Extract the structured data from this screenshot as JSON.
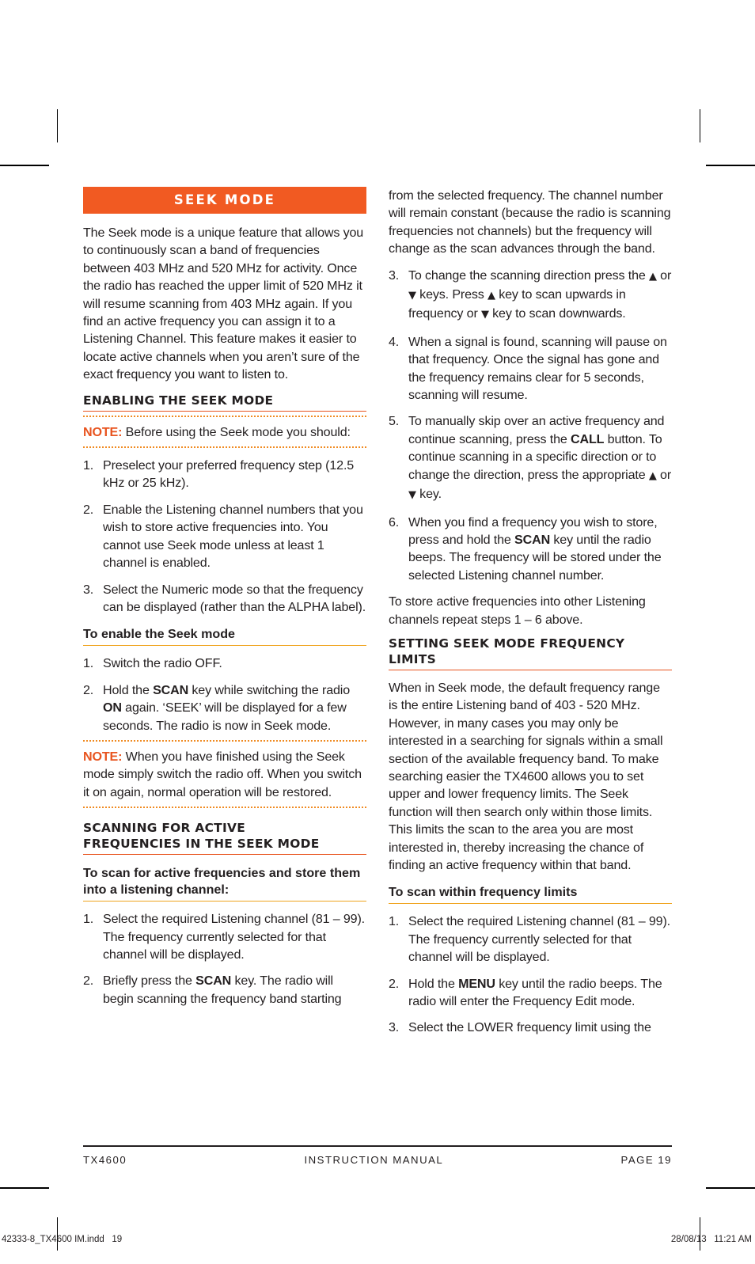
{
  "banner": {
    "title": "SEEK MODE"
  },
  "left_column": {
    "intro": "The Seek mode is a unique feature that allows you to continuously scan a band of frequencies between 403 MHz and 520 MHz for activity. Once the radio has reached the upper limit of 520 MHz it will resume scanning from 403 MHz again. If you find an active frequency you can assign it to a Listening Channel. This feature makes it easier to locate active channels when you aren’t sure of the exact frequency you want to listen to.",
    "section_enabling": "ENABLING THE SEEK MODE",
    "note1_label": "NOTE:",
    "note1_text": " Before using the Seek mode you should:",
    "steps_prep": [
      {
        "num": "1.",
        "text": "Preselect your preferred frequency step (12.5 kHz or 25 kHz)."
      },
      {
        "num": "2.",
        "text": "Enable the Listening channel numbers that you wish to store active frequencies into. You cannot use Seek mode unless at least 1 channel is enabled."
      },
      {
        "num": "3.",
        "text": "Select the Numeric mode so that the frequency can be displayed (rather than the ALPHA label)."
      }
    ],
    "subhead_enable": "To enable the Seek mode",
    "step_enable_1_num": "1.",
    "step_enable_1_text": "Switch the radio OFF.",
    "step_enable_2_num": "2.",
    "step_enable_2_a": "Hold the ",
    "step_enable_2_key1": "SCAN",
    "step_enable_2_b": " key while switching the radio ",
    "step_enable_2_key2": "ON",
    "step_enable_2_c": " again. ‘SEEK’ will be displayed for a few seconds. The radio is now in Seek mode.",
    "note2_label": "NOTE:",
    "note2_text": " When you have finished using the Seek mode simply switch the radio off. When you switch it on again, normal operation will be restored.",
    "section_scanning_line1": "SCANNING FOR ACTIVE",
    "section_scanning_line2": "FREQUENCIES IN THE SEEK MODE",
    "subhead_scan": "To scan for active frequencies and store them into a listening channel:",
    "step_scan_1_num": "1.",
    "step_scan_1_text": "Select the required Listening channel (81 – 99). The frequency currently selected for that channel will be displayed.",
    "step_scan_2_num": "2.",
    "step_scan_2_a": "Briefly press the ",
    "step_scan_2_key": "SCAN",
    "step_scan_2_b": " key. The radio will begin scanning the frequency band starting"
  },
  "right_column": {
    "continued_text": "from the selected frequency. The channel number will remain constant (because the radio is scanning frequencies not channels) but the frequency will change as the scan advances through the band.",
    "step3_num": "3.",
    "step3_a": "To change the scanning direction press the ",
    "step3_tri_up1": "▲",
    "step3_b": " or ",
    "step3_tri_down1": "▼",
    "step3_c": " keys. Press ",
    "step3_tri_up2": "▲",
    "step3_d": " key to scan upwards in frequency or ",
    "step3_tri_down2": "▼",
    "step3_e": " key to scan downwards.",
    "step4_num": "4.",
    "step4_text": "When a signal is found, scanning will pause on that frequency. Once the signal has gone and the frequency remains clear for 5 seconds, scanning will resume.",
    "step5_num": "5.",
    "step5_a": "To manually skip over an active frequency and continue scanning, press the ",
    "step5_key": "CALL",
    "step5_b": " button. To continue scanning in a specific direction or to change the direction, press the appropriate ",
    "step5_tri_up": "▲",
    "step5_c": " or ",
    "step5_tri_down": "▼",
    "step5_d": " key.",
    "step6_num": "6.",
    "step6_a": "When you find a frequency you wish to store, press and hold the ",
    "step6_key": "SCAN",
    "step6_b": " key until the radio beeps. The frequency will be stored under the selected Listening channel number.",
    "store_repeat": "To store active frequencies into other Listening channels repeat steps 1 – 6 above.",
    "section_limits_line1": "SETTING SEEK MODE FREQUENCY",
    "section_limits_line2": "LIMITS",
    "limits_paragraph": "When in Seek mode, the default frequency range is the entire Listening band of 403 - 520 MHz. However, in many cases you may only be interested in a searching for signals within a small section of the available frequency band. To make searching easier the TX4600 allows you to set upper and lower frequency limits. The Seek function will then search only within those limits. This limits the scan to the area you are most interested in, thereby increasing the chance of finding an active frequency within that band.",
    "subhead_limits": "To scan within frequency limits",
    "lim_step1_num": "1.",
    "lim_step1_text": "Select the required Listening channel (81 – 99). The frequency currently selected for that channel will be displayed.",
    "lim_step2_num": "2.",
    "lim_step2_a": "Hold the ",
    "lim_step2_key": "MENU",
    "lim_step2_b": " key until the radio beeps. The radio will enter the Frequency Edit mode.",
    "lim_step3_num": "3.",
    "lim_step3_text": "Select the LOWER frequency limit using the"
  },
  "footer": {
    "left": "TX4600",
    "center": "INSTRUCTION MANUAL",
    "right": "PAGE 19"
  },
  "slug": {
    "left": "42333-8_TX4600 IM.indd   19",
    "right": "28/08/13   11:21 AM"
  },
  "colors": {
    "banner_orange": "#f15a22",
    "rule_orange": "#e8541f",
    "rule_amber": "#f0a41e",
    "dot_orange": "#f08b22",
    "text": "#231f20"
  }
}
